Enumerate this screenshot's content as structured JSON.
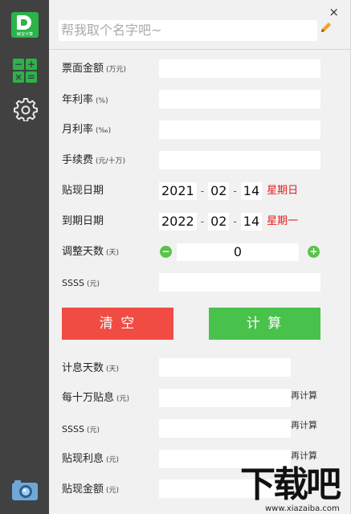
{
  "window": {
    "close_glyph": "×",
    "name_placeholder": "帮我取个名字吧~"
  },
  "sidebar": {
    "logo_text": "鲸宝计算",
    "icons": [
      "app-logo-icon",
      "calculator-icon",
      "settings-gear-icon",
      "camera-icon"
    ],
    "calc_glyphs": [
      "−",
      "+",
      "×",
      "="
    ]
  },
  "form": {
    "face_amount": {
      "label": "票面金额",
      "unit": "(万元)",
      "value": ""
    },
    "annual_rate": {
      "label": "年利率",
      "unit": "(%)",
      "value": ""
    },
    "monthly_rate": {
      "label": "月利率",
      "unit": "(‰)",
      "value": ""
    },
    "fee": {
      "label": "手续费",
      "unit": "(元/十万)",
      "value": ""
    },
    "discount_date": {
      "label": "贴现日期",
      "year": "2021",
      "month": "02",
      "day": "14",
      "weekday": "星期日"
    },
    "due_date": {
      "label": "到期日期",
      "year": "2022",
      "month": "02",
      "day": "14",
      "weekday": "星期一"
    },
    "adjust_days": {
      "label": "调整天数",
      "unit": "(天)",
      "value": "0",
      "minus": "−",
      "plus": "+"
    },
    "ssss_input": {
      "label": "SSSS",
      "unit": "(元)",
      "value": ""
    },
    "date_separator": "-"
  },
  "buttons": {
    "clear": "清 空",
    "calculate": "计 算"
  },
  "results": {
    "interest_days": {
      "label": "计息天数",
      "unit": "(天)",
      "value": ""
    },
    "per_100k_interest": {
      "label": "每十万贴息",
      "unit": "(元)",
      "value": "",
      "action": "再计算"
    },
    "ssss_result": {
      "label": "SSSS",
      "unit": "(元)",
      "value": "",
      "action": "再计算"
    },
    "discount_interest": {
      "label": "贴现利息",
      "unit": "(元)",
      "value": "",
      "action": "再计算"
    },
    "discount_amount": {
      "label": "贴现金额",
      "unit": "(元)",
      "value": ""
    }
  },
  "watermark": {
    "big": "下载吧",
    "small": "www.xiazaiba.com"
  },
  "colors": {
    "sidebar": "#414141",
    "accent_green": "#49c24b",
    "clear_red": "#f04c44",
    "weekday_red": "#e02020",
    "panel_bg": "#f1f1f1"
  }
}
